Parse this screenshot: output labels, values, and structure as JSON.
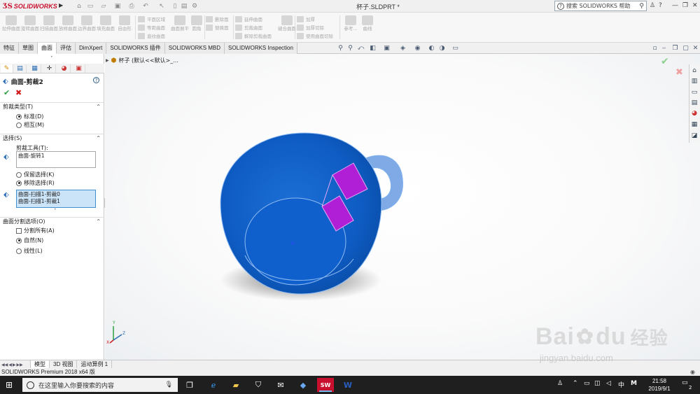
{
  "titlebar": {
    "logo_ds": "ƷS",
    "logo_text": "SOLIDWORKS",
    "doc_title": "杯子.SLDPRT *",
    "help_search": "搜索 SOLIDWORKS 帮助",
    "help_glyph": "?"
  },
  "commands": {
    "big": [
      "拉伸曲面",
      "旋转曲面",
      "扫描曲面",
      "放样曲面",
      "边界曲面",
      "填充曲面",
      "自由形"
    ],
    "group1": [
      "平面区域",
      "等距曲面",
      "直纹曲面"
    ],
    "flatten": "曲面展平",
    "fillet": "圆角",
    "group2": [
      "删除面",
      "替换面"
    ],
    "group3": [
      "延伸曲面",
      "剪裁曲面",
      "解除剪裁曲面"
    ],
    "knit": "缝合曲面",
    "group4": [
      "加厚",
      "加厚切除",
      "使用曲面切除"
    ],
    "reference": "参考...",
    "curves": "曲线"
  },
  "tabs": [
    "特征",
    "草图",
    "曲面",
    "评估",
    "DimXpert",
    "SOLIDWORKS 插件",
    "SOLIDWORKS MBD",
    "SOLIDWORKS Inspection"
  ],
  "active_tab": "曲面",
  "property_manager": {
    "title": "曲面-剪裁2",
    "help": "?",
    "ok": "✔",
    "cancel": "✖",
    "trim_type": {
      "header": "剪裁类型(T)",
      "options": [
        "标准(D)",
        "相互(M)"
      ]
    },
    "selection": {
      "header": "选择(S)",
      "tool_label": "剪裁工具(T):",
      "tool_value": "曲面-旋转1",
      "keep": "保留选择(K)",
      "remove": "移除选择(R)",
      "items": [
        "曲面-扫描1-剪裁0",
        "曲面-扫描1-剪裁1"
      ]
    },
    "split": {
      "header": "曲面分割选项(O)",
      "split_all": "分割所有(A)",
      "natural": "自然(N)",
      "linear": "线性(L)"
    }
  },
  "tree_caption": "杯子 (默认<<默认>_...",
  "triad": {
    "x": "X",
    "y": "Y",
    "z": "Z"
  },
  "bottom_tabs": [
    "模型",
    "3D 视图",
    "运动算例 1"
  ],
  "status_text": "SOLIDWORKS Premium 2018 x64 版",
  "taskbar": {
    "search_placeholder": "在这里输入你要搜索的内容",
    "ime": "中",
    "ime2": "M",
    "time": "21:58",
    "date": "2019/9/1",
    "notif": "2"
  },
  "watermark": {
    "brand": "Bai",
    "brand2": "du",
    "cn": "经验",
    "url": "jingyan.baidu.com"
  },
  "colors": {
    "cup_blue": "#0a5bbf",
    "trim_purple": "#b01fd6",
    "accent_red": "#c8102e"
  }
}
